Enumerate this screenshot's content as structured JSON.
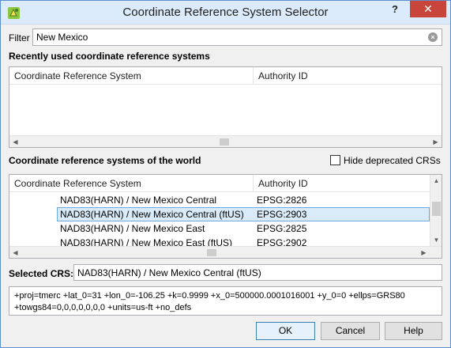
{
  "window": {
    "title": "Coordinate Reference System Selector",
    "help_label": "?",
    "close_label": "✕"
  },
  "filter": {
    "label": "Filter",
    "value": "New Mexico",
    "clear_label": "×"
  },
  "recent": {
    "heading": "Recently used coordinate reference systems",
    "columns": [
      "Coordinate Reference System",
      "Authority ID"
    ],
    "rows": []
  },
  "world": {
    "heading": "Coordinate reference systems of the world",
    "hide_deprecated_label": "Hide deprecated CRSs",
    "hide_deprecated_checked": false,
    "columns": [
      "Coordinate Reference System",
      "Authority ID"
    ],
    "rows": [
      {
        "name": "NAD83(HARN) / New Mexico Central",
        "authid": "EPSG:2826",
        "selected": false
      },
      {
        "name": "NAD83(HARN) / New Mexico Central (ftUS)",
        "authid": "EPSG:2903",
        "selected": true
      },
      {
        "name": "NAD83(HARN) / New Mexico East",
        "authid": "EPSG:2825",
        "selected": false
      },
      {
        "name": "NAD83(HARN) / New Mexico East (ftUS)",
        "authid": "EPSG:2902",
        "selected": false
      }
    ]
  },
  "selected": {
    "label": "Selected CRS:",
    "value": "NAD83(HARN) / New Mexico Central (ftUS)"
  },
  "proj_string": {
    "line1": "+proj=tmerc +lat_0=31 +lon_0=-106.25 +k=0.9999 +x_0=500000.0001016001 +y_0=0 +ellps=GRS80",
    "line2": "+towgs84=0,0,0,0,0,0,0 +units=us-ft +no_defs"
  },
  "buttons": {
    "ok": "OK",
    "cancel": "Cancel",
    "help": "Help"
  },
  "colors": {
    "titlebar": "#dcebfb",
    "close_button": "#c7453b",
    "selection": "#d9ebf9",
    "selection_border": "#6fa8dc"
  }
}
